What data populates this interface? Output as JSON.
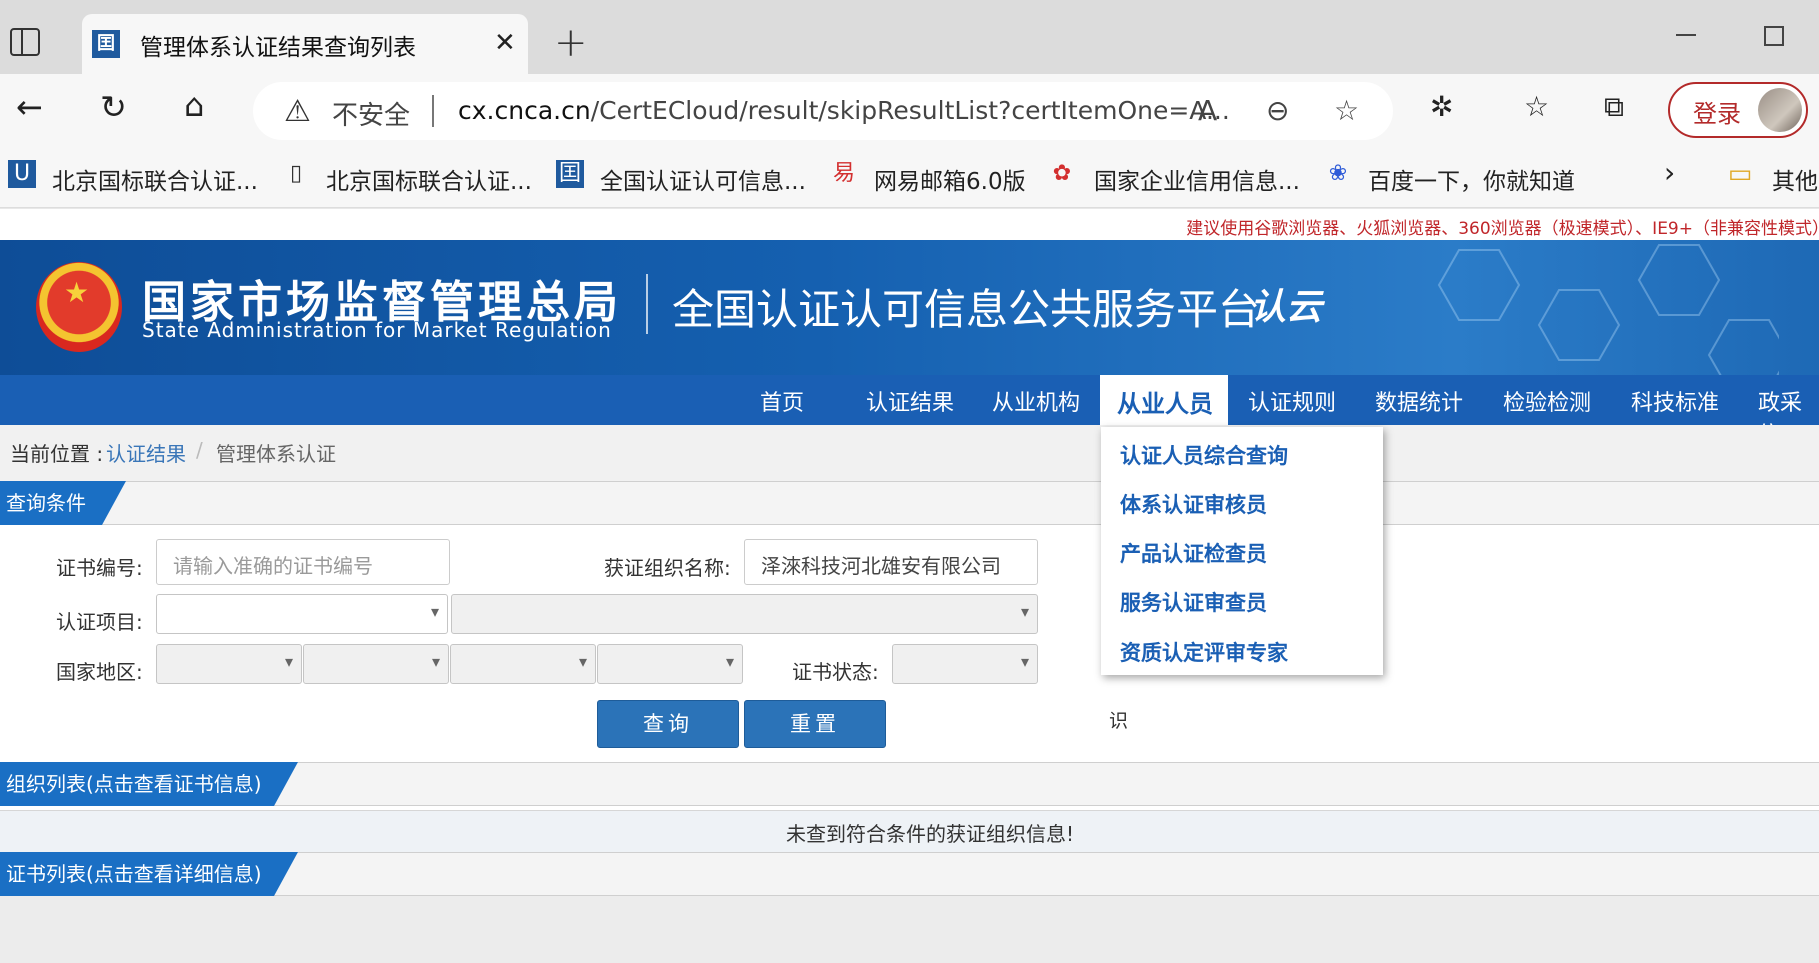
{
  "browser": {
    "tab_title": "管理体系认证结果查询列表",
    "tab_favicon_text": "囯",
    "insecure_label": "不安全",
    "url_domain": "cx.cnca.cn",
    "url_path": "/CertECloud/result/skipResultList?certItemOne=A...",
    "login_label": "登录"
  },
  "bookmarks": [
    {
      "label": "北京国标联合认证...",
      "icon": "bookmark-site-icon"
    },
    {
      "label": "北京国标联合认证...",
      "icon": "page-icon"
    },
    {
      "label": "全国认证认可信息...",
      "icon": "cnca-icon"
    },
    {
      "label": "网易邮箱6.0版",
      "icon": "netease-icon"
    },
    {
      "label": "国家企业信用信息...",
      "icon": "huawei-icon"
    },
    {
      "label": "百度一下，你就知道",
      "icon": "baidu-icon"
    },
    {
      "label": "其他",
      "icon": "folder-icon"
    }
  ],
  "site": {
    "notice": "建议使用谷歌浏览器、火狐浏览器、360浏览器（极速模式）、IE9+（非兼容性模式）",
    "agency_cn": "国家市场监督管理总局",
    "agency_en": "State Administration  for  Market Regulation",
    "platform_name": "全国认证认可信息公共服务平台",
    "logo_text": "认云"
  },
  "mainnav": {
    "items": [
      "首页",
      "认证结果",
      "从业机构",
      "从业人员",
      "认证规则",
      "数据统计",
      "检验检测",
      "科技标准",
      "政采信"
    ],
    "active_index": 3
  },
  "breadcrumb": {
    "prefix": "当前位置 : ",
    "parent": "认证结果",
    "separator": "/",
    "current": "管理体系认证"
  },
  "sections": {
    "query": "查询条件",
    "org_list": "组织列表(点击查看证书信息)",
    "cert_list": "证书列表(点击查看详细信息)"
  },
  "form": {
    "cert_no_label": "证书编号:",
    "cert_no_placeholder": "请输入准确的证书编号",
    "org_name_label": "获证组织名称:",
    "org_name_value": "泽淶科技河北雄安有限公司",
    "cert_item_label": "认证项目:",
    "region_label": "国家地区:",
    "cert_status_label": "证书状态:",
    "query_button": "查询",
    "reset_button": "重置"
  },
  "dropdown": {
    "items": [
      "认证人员综合查询",
      "体系认证审核员",
      "产品认证检查员",
      "服务认证审查员",
      "资质认定评审专家"
    ]
  },
  "stray_char": "识",
  "results": {
    "empty_message": "未查到符合条件的获证组织信息!"
  },
  "colors": {
    "brand_blue": "#1a5fb4",
    "section_blue": "#1a6fc4",
    "notice_red": "#c0262a",
    "button_blue": "#2b73b8"
  }
}
